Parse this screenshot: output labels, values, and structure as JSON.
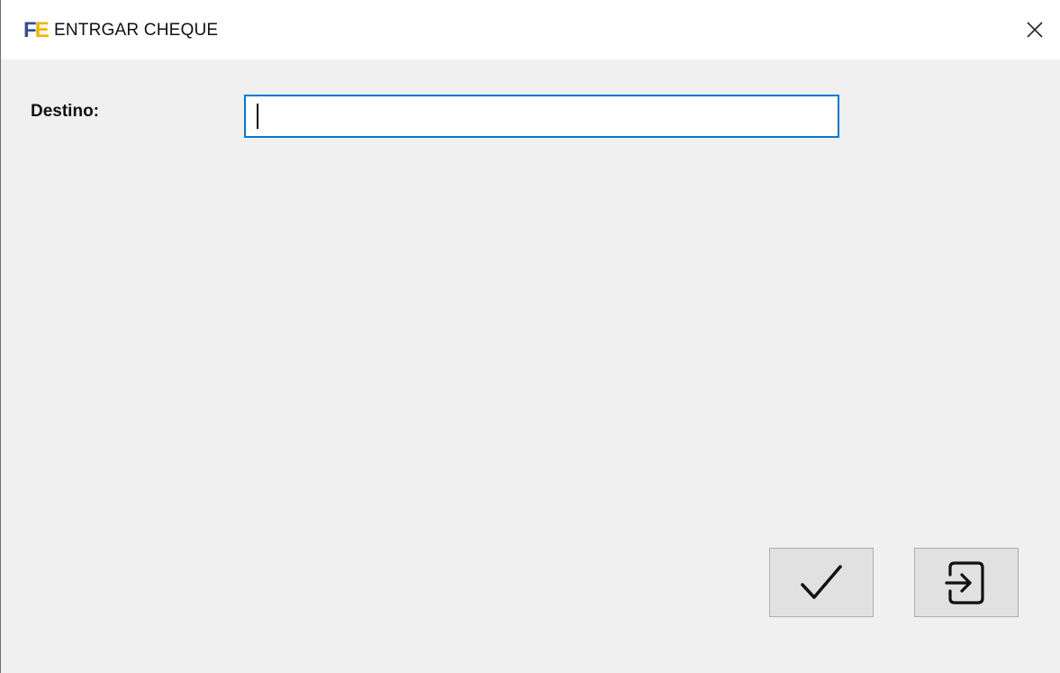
{
  "window": {
    "title": "ENTRGAR CHEQUE",
    "app_icon": {
      "letters_primary": "F",
      "letters_secondary": "E",
      "primary_color": "#2f4f9e",
      "secondary_color": "#f2b400"
    },
    "close_icon": "close-icon"
  },
  "form": {
    "destino_label": "Destino:",
    "destino_value": "",
    "focus_color": "#0078d7"
  },
  "actions": {
    "confirm_icon": "checkmark-icon",
    "exit_icon": "exit-icon"
  }
}
